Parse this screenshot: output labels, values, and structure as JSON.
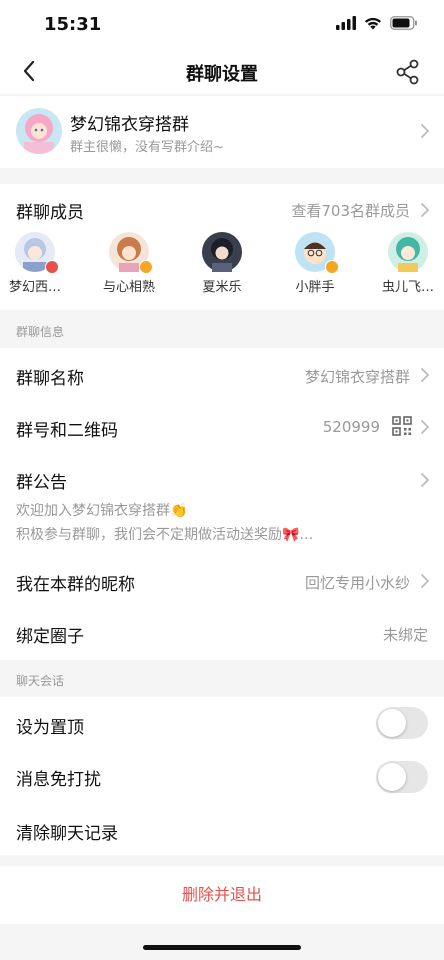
{
  "status_bar": {
    "time": "15:31"
  },
  "nav": {
    "title": "群聊设置"
  },
  "group": {
    "name": "梦幻锦衣穿搭群",
    "desc": "群主很懒，没有写群介绍~"
  },
  "members": {
    "label": "群聊成员",
    "view_all": "查看703名群成员",
    "list": [
      {
        "name": "梦幻西…",
        "badge_color": "#e8504a"
      },
      {
        "name": "与心相熟",
        "badge_color": "#f5a623"
      },
      {
        "name": "夏米乐",
        "badge_color": ""
      },
      {
        "name": "小胖手",
        "badge_color": "#f5a623"
      },
      {
        "name": "虫儿飞…",
        "badge_color": ""
      }
    ]
  },
  "info": {
    "header": "群聊信息",
    "name_label": "群聊名称",
    "name_value": "梦幻锦衣穿搭群",
    "id_label": "群号和二维码",
    "id_value": "520999",
    "notice_label": "群公告",
    "notice_line1": "欢迎加入梦幻锦衣穿搭群👏",
    "notice_line2": "积极参与群聊，我们会不定期做活动送奖励🎀…",
    "nickname_label": "我在本群的昵称",
    "nickname_value": "回忆专用小水纱",
    "circle_label": "绑定圈子",
    "circle_value": "未绑定"
  },
  "chat": {
    "header": "聊天会话",
    "pin_label": "设为置顶",
    "pin_on": false,
    "mute_label": "消息免打扰",
    "mute_on": false,
    "clear_label": "清除聊天记录"
  },
  "footer": {
    "delete_label": "删除并退出"
  },
  "colors": {
    "accent_red": "#e8504a",
    "toggle_off": "#e6e6e6"
  }
}
